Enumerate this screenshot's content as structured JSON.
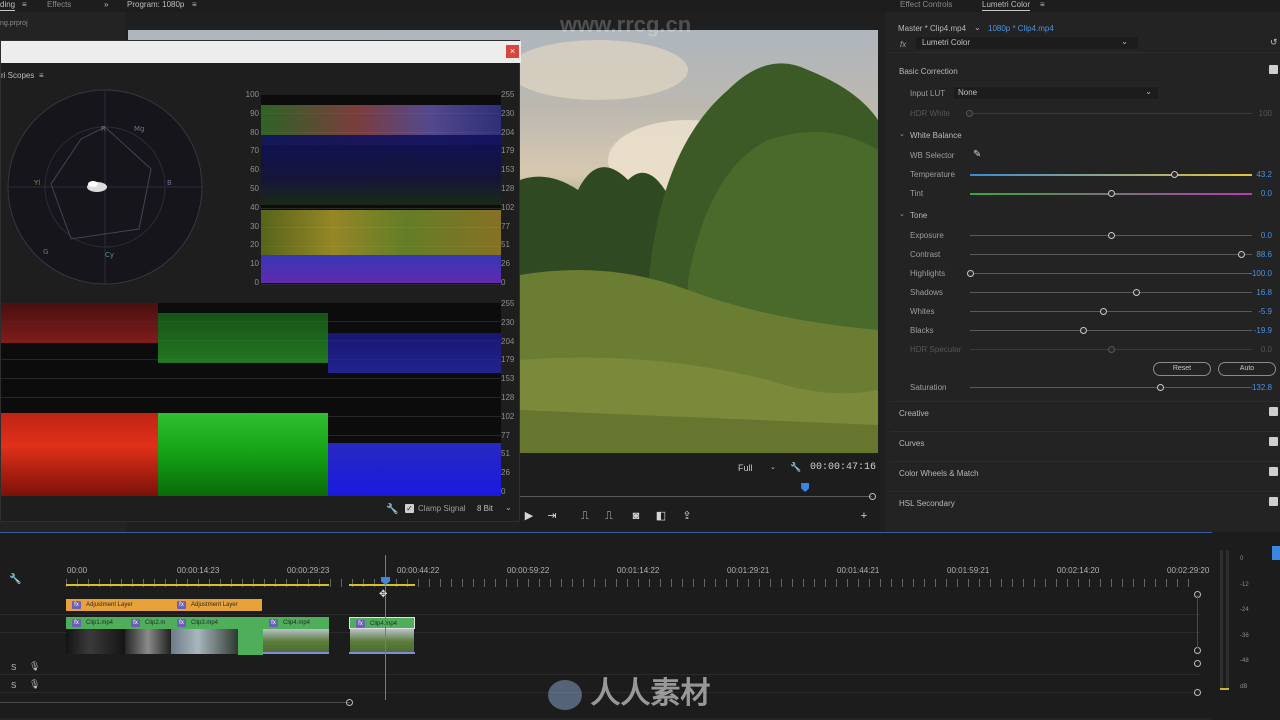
{
  "top_tabs": {
    "left_tab": "ding",
    "left_sub": "ng.prproj",
    "effects_tab": "Effects",
    "expand_icon": "chevrons-right-icon",
    "program_label": "Program: 1080p",
    "effect_controls_tab": "Effect Controls",
    "lumetri_tab": "Lumetri Color"
  },
  "scopes": {
    "label": "ri Scopes",
    "scale_percent": [
      "100",
      "90",
      "80",
      "70",
      "60",
      "50",
      "40",
      "30",
      "20",
      "10",
      "0"
    ],
    "scale_8bit": [
      "255",
      "230",
      "204",
      "179",
      "153",
      "128",
      "102",
      "77",
      "51",
      "26",
      "0"
    ],
    "clamp_label": "Clamp Signal",
    "clamp_checked": true,
    "bit_depth": "8 Bit",
    "vector_labels": [
      "R",
      "Mg",
      "B",
      "Cy",
      "G",
      "Yl"
    ]
  },
  "monitor": {
    "resolution": "Full",
    "timecode": "00:00:47:16",
    "playhead_fraction": 0.81
  },
  "lumetri": {
    "master_clip": "Master * Clip4.mp4",
    "seq_clip": "1080p * Clip4.mp4",
    "effect_name": "Lumetri Color",
    "basic_correction": "Basic Correction",
    "input_lut_label": "Input LUT",
    "input_lut_value": "None",
    "hdr_white_label": "HDR White",
    "hdr_white_value": "100",
    "white_balance": "White Balance",
    "wb_selector": "WB Selector",
    "tone": "Tone",
    "sliders": [
      {
        "label": "Temperature",
        "value": "43.2",
        "pos": 0.725
      },
      {
        "label": "Tint",
        "value": "0.0",
        "pos": 0.5
      },
      {
        "label": "Exposure",
        "value": "0.0",
        "pos": 0.5
      },
      {
        "label": "Contrast",
        "value": "88.6",
        "pos": 0.96
      },
      {
        "label": "Highlights",
        "value": "-100.0",
        "pos": 0.0
      },
      {
        "label": "Shadows",
        "value": "16.8",
        "pos": 0.59
      },
      {
        "label": "Whites",
        "value": "-5.9",
        "pos": 0.47
      },
      {
        "label": "Blacks",
        "value": "-19.9",
        "pos": 0.4
      },
      {
        "label": "HDR Specular",
        "value": "0.0",
        "pos": 0.5
      },
      {
        "label": "Saturation",
        "value": "132.8",
        "pos": 0.675
      }
    ],
    "reset_btn": "Reset",
    "auto_btn": "Auto",
    "sections": [
      "Creative",
      "Curves",
      "Color Wheels & Match",
      "HSL Secondary"
    ]
  },
  "timeline": {
    "ticks": [
      "00:00",
      "00:00:14:23",
      "00:00:29:23",
      "00:00:44:22",
      "00:00:59:22",
      "00:01:14:22",
      "00:01:29:21",
      "00:01:44:21",
      "00:01:59:21",
      "00:02:14:20",
      "00:02:29:20"
    ],
    "adjustment_layers": [
      "Adjustment Layer",
      "Adjustment Layer"
    ],
    "clips": [
      "Clip1.mp4",
      "Clip2.m",
      "Clip3.mp4",
      "Clip4.mp4",
      "Clip4.mp4"
    ],
    "audio_tracks": [
      "S",
      "S"
    ],
    "meter_scale": [
      "0",
      "-12",
      "-24",
      "-36",
      "-48",
      "dB"
    ]
  },
  "watermarks": [
    "www.rrcg.cn",
    "RRCG",
    "人人素材"
  ]
}
